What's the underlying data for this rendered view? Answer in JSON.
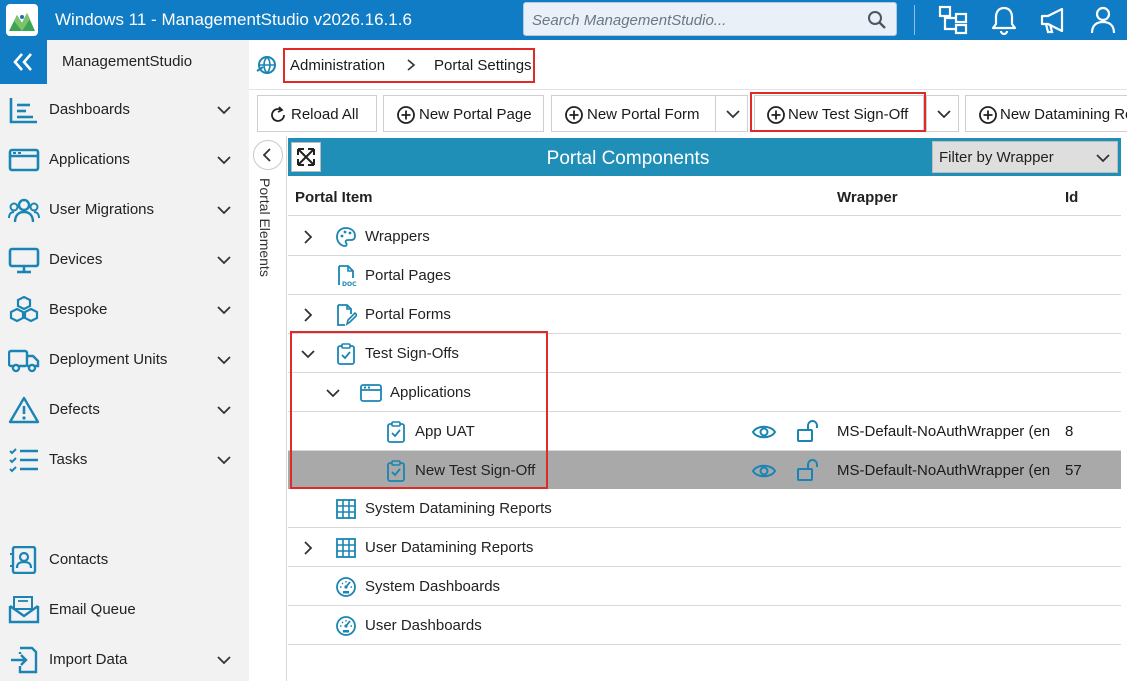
{
  "titlebar": {
    "title": "Windows 11 - ManagementStudio v2026.16.1.6",
    "search_placeholder": "Search ManagementStudio...",
    "icons": [
      "logo-icon",
      "search-icon",
      "org-chart-icon",
      "bell-icon",
      "megaphone-icon",
      "user-icon"
    ]
  },
  "sidebar": {
    "brand": "ManagementStudio",
    "items": [
      {
        "label": "Dashboards",
        "icon": "dashboard-list-icon",
        "chevron": true
      },
      {
        "label": "Applications",
        "icon": "window-icon",
        "chevron": true
      },
      {
        "label": "User Migrations",
        "icon": "users-icon",
        "chevron": true
      },
      {
        "label": "Devices",
        "icon": "monitor-icon",
        "chevron": true
      },
      {
        "label": "Bespoke",
        "icon": "cubes-icon",
        "chevron": true
      },
      {
        "label": "Deployment Units",
        "icon": "truck-icon",
        "chevron": true
      },
      {
        "label": "Defects",
        "icon": "warning-icon",
        "chevron": true
      },
      {
        "label": "Tasks",
        "icon": "task-list-icon",
        "chevron": true
      },
      {
        "label": "Contacts",
        "icon": "contact-card-icon",
        "chevron": false
      },
      {
        "label": "Email Queue",
        "icon": "email-icon",
        "chevron": false
      },
      {
        "label": "Import Data",
        "icon": "import-icon",
        "chevron": true
      }
    ]
  },
  "breadcrumb": {
    "items": [
      "Administration",
      "Portal Settings"
    ]
  },
  "toolbar": {
    "reload": "Reload All",
    "new_page": "New Portal Page",
    "new_form": "New Portal Form",
    "new_signoff": "New Test Sign-Off",
    "new_datamining": "New Datamining Re"
  },
  "side_panel": {
    "label": "Portal Elements"
  },
  "portal_components": {
    "title": "Portal Components",
    "filter": "Filter by Wrapper",
    "columns": {
      "item": "Portal Item",
      "wrapper": "Wrapper",
      "id": "Id"
    },
    "rows": [
      {
        "label": "Wrappers",
        "icon": "palette-icon",
        "level": 0,
        "expand": "collapsed",
        "wrapper": "",
        "id": ""
      },
      {
        "label": "Portal Pages",
        "icon": "doc-file-icon",
        "level": 0,
        "expand": "none",
        "wrapper": "",
        "id": ""
      },
      {
        "label": "Portal Forms",
        "icon": "form-edit-icon",
        "level": 0,
        "expand": "collapsed",
        "wrapper": "",
        "id": ""
      },
      {
        "label": "Test Sign-Offs",
        "icon": "clipboard-check-icon",
        "level": 0,
        "expand": "expanded",
        "wrapper": "",
        "id": ""
      },
      {
        "label": "Applications",
        "icon": "app-window-icon",
        "level": 1,
        "expand": "expanded",
        "wrapper": "",
        "id": ""
      },
      {
        "label": "App UAT",
        "icon": "clipboard-check-icon",
        "level": 2,
        "expand": "none",
        "wrapper": "MS-Default-NoAuthWrapper (en",
        "id": "8"
      },
      {
        "label": "New Test Sign-Off",
        "icon": "clipboard-check-icon",
        "level": 2,
        "expand": "none",
        "wrapper": "MS-Default-NoAuthWrapper (en",
        "id": "57",
        "selected": true
      },
      {
        "label": "System Datamining Reports",
        "icon": "grid-icon",
        "level": 0,
        "expand": "none",
        "wrapper": "",
        "id": ""
      },
      {
        "label": "User Datamining Reports",
        "icon": "grid-icon",
        "level": 0,
        "expand": "collapsed",
        "wrapper": "",
        "id": ""
      },
      {
        "label": "System Dashboards",
        "icon": "gauge-icon",
        "level": 0,
        "expand": "none",
        "wrapper": "",
        "id": ""
      },
      {
        "label": "User Dashboards",
        "icon": "gauge-icon",
        "level": 0,
        "expand": "none",
        "wrapper": "",
        "id": ""
      }
    ]
  },
  "colors": {
    "titlebar": "#0f7cc5",
    "accent_icon": "#1a85b4",
    "panel_header": "#1f8fb8",
    "highlight_box": "#e02a2a",
    "selected_row": "#a9a9a9"
  }
}
